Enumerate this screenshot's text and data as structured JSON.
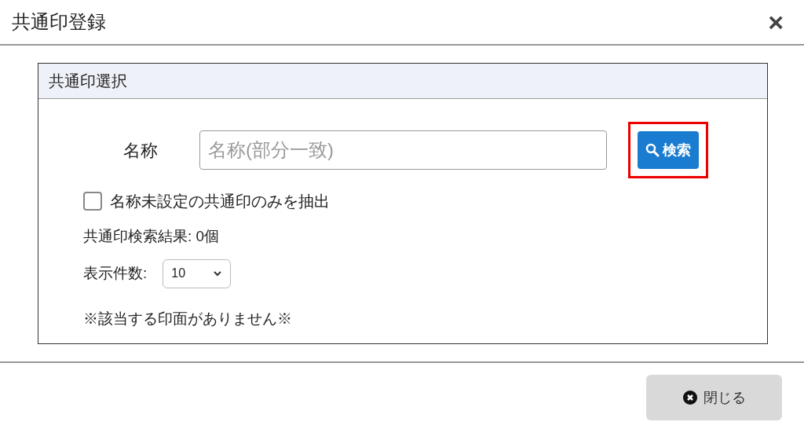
{
  "window": {
    "title": "共通印登録",
    "close": "×"
  },
  "panel": {
    "title": "共通印選択",
    "name_label": "名称",
    "name_field": {
      "placeholder": "名称(部分一致)"
    },
    "search_button": {
      "label": "検索",
      "highlighted": true
    },
    "unnamed_only": {
      "label": "名称未設定の共通印のみを抽出",
      "checked": false
    },
    "result_count": "共通印検索結果: 0個",
    "page_size": {
      "label": "表示件数:",
      "value": "10"
    },
    "message": "※該当する印面がありません※"
  },
  "footer": {
    "close_button": "閉じる"
  }
}
